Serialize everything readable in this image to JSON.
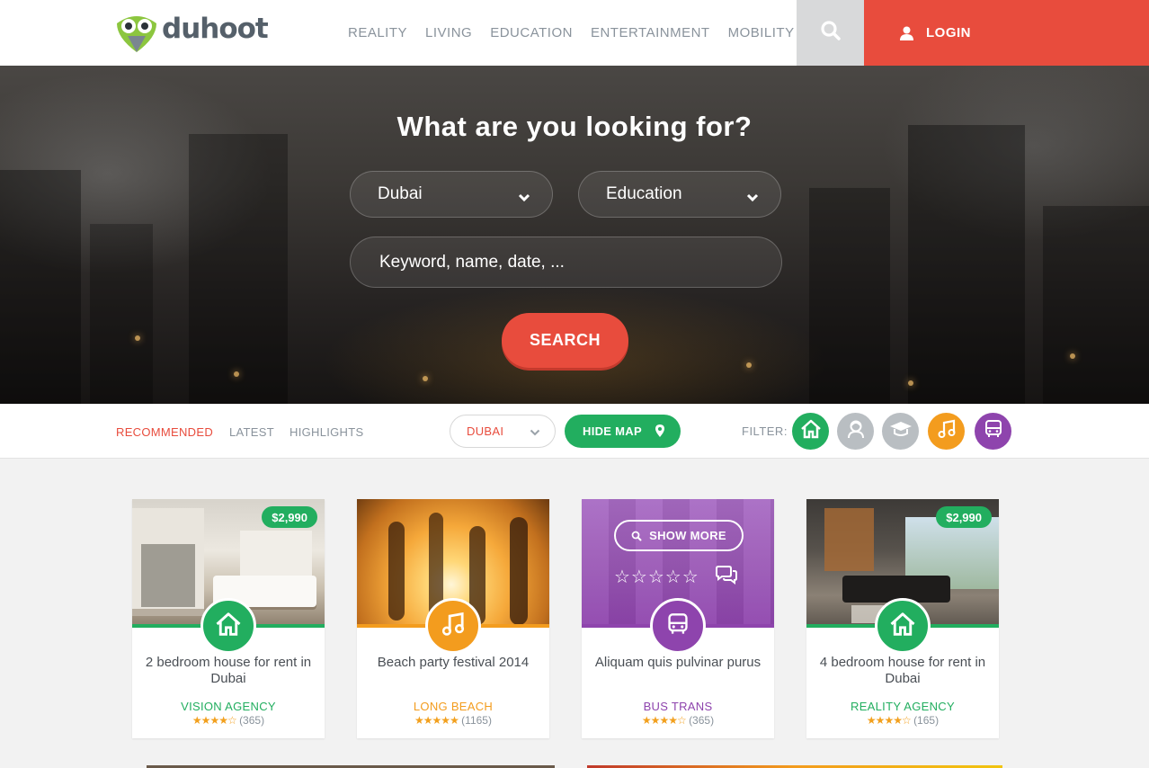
{
  "brand": {
    "name": "duhoot"
  },
  "nav": {
    "items": [
      "REALITY",
      "LIVING",
      "EDUCATION",
      "ENTERTAINMENT",
      "MOBILITY"
    ]
  },
  "header": {
    "login_label": "LOGIN"
  },
  "hero": {
    "title": "What are you looking for?",
    "location_value": "Dubai",
    "category_value": "Education",
    "keyword_placeholder": "Keyword, name, date, ...",
    "search_label": "SEARCH"
  },
  "filterbar": {
    "tabs": [
      "RECOMMENDED",
      "LATEST",
      "HIGHLIGHTS"
    ],
    "active_tab": "RECOMMENDED",
    "city_value": "DUBAI",
    "hide_map_label": "HIDE MAP",
    "filter_label": "FILTER:",
    "filters": [
      {
        "icon": "home-icon",
        "color": "#22ae5f"
      },
      {
        "icon": "person-icon",
        "color": "#b9bec2"
      },
      {
        "icon": "graduation-cap-icon",
        "color": "#b9bec2"
      },
      {
        "icon": "music-icon",
        "color": "#f39c1e"
      },
      {
        "icon": "bus-icon",
        "color": "#8e44ad"
      }
    ]
  },
  "cards": [
    {
      "title": "2 bedroom house for rent in Dubai",
      "agency": "VISION AGENCY",
      "rating": 4,
      "reviews": "(365)",
      "price": "$2,990",
      "icon": "home-icon",
      "color": "#22ae5f"
    },
    {
      "title": "Beach party festival 2014",
      "agency": "LONG BEACH",
      "rating": 5,
      "reviews": "(1165)",
      "price": "",
      "icon": "music-icon",
      "color": "#f39c1e"
    },
    {
      "title": "Aliquam quis pulvinar purus",
      "agency": "BUS TRANS",
      "rating": 4,
      "reviews": "(365)",
      "price": "",
      "icon": "bus-icon",
      "color": "#8e44ad",
      "show_more_label": "SHOW MORE"
    },
    {
      "title": "4 bedroom house for rent in Dubai",
      "agency": "REALITY AGENCY",
      "rating": 4,
      "reviews": "(165)",
      "price": "$2,990",
      "icon": "home-icon",
      "color": "#22ae5f"
    }
  ],
  "colors": {
    "accent": "#e84c3d",
    "green": "#22ae5f",
    "orange": "#f39c1e",
    "purple": "#8e44ad"
  }
}
